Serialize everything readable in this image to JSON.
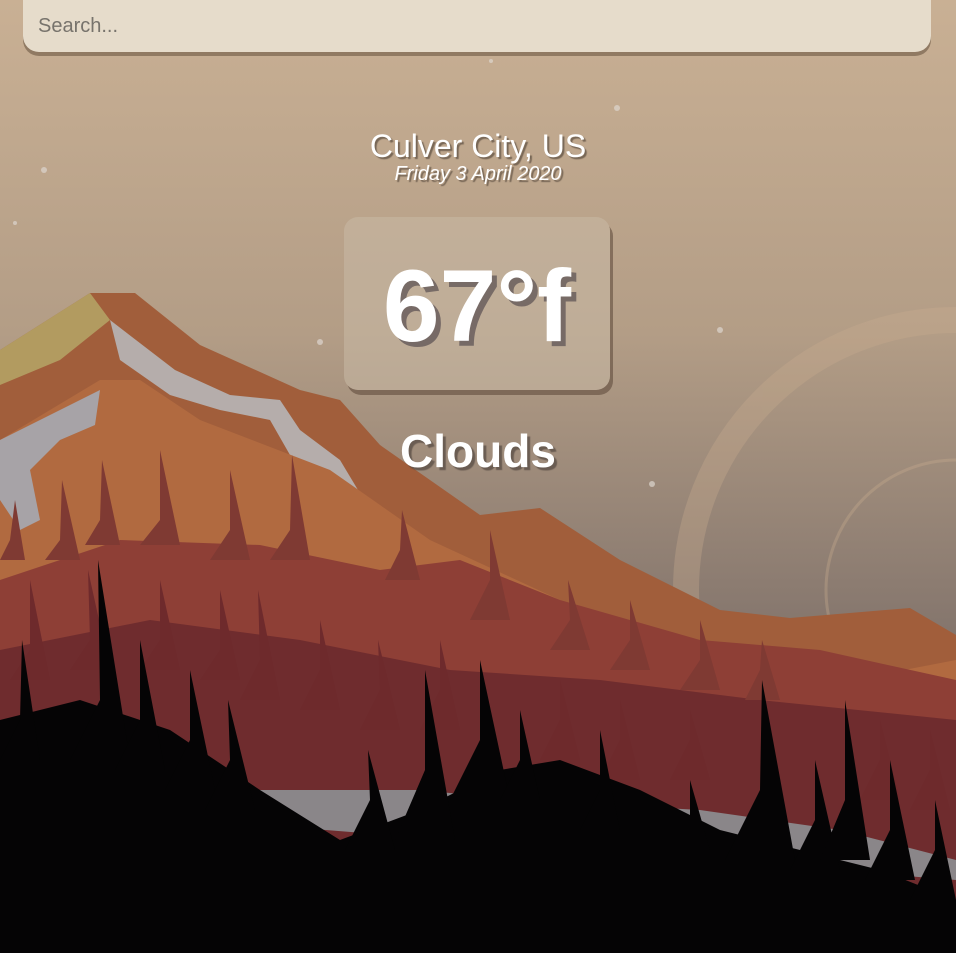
{
  "search": {
    "placeholder": "Search..."
  },
  "location": {
    "city": "Culver City, US",
    "date": "Friday 3 April 2020"
  },
  "weather": {
    "temperature": "67°f",
    "condition": "Clouds"
  },
  "colors": {
    "sky_top": "#c7ae92",
    "sky_bottom": "#7a6d66",
    "search_bg": "#e6dccb",
    "mountain_far": "#a65f3a",
    "mountain_mid": "#8e3a35",
    "forest_dark": "#050405"
  }
}
